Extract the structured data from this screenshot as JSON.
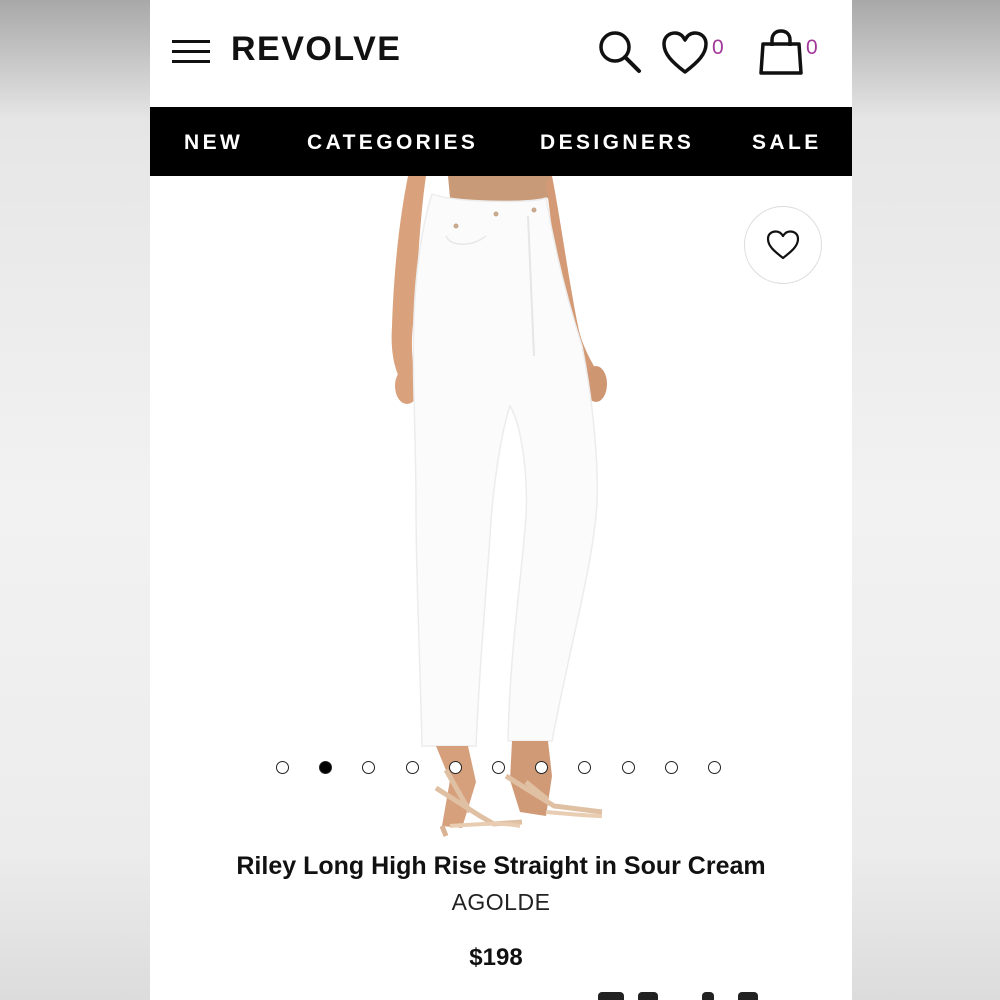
{
  "header": {
    "logo": "REVOLVE",
    "wishlist_count": "0",
    "bag_count": "0",
    "icons": {
      "menu": "hamburger-menu-icon",
      "search": "search-icon",
      "wishlist": "heart-icon",
      "bag": "shopping-bag-icon"
    },
    "count_color": "#a2379a"
  },
  "nav": {
    "items": [
      {
        "label": "NEW"
      },
      {
        "label": "CATEGORIES"
      },
      {
        "label": "DESIGNERS"
      },
      {
        "label": "SALE"
      }
    ]
  },
  "gallery": {
    "image_count": 11,
    "active_index": 1,
    "favorite_icon": "heart-icon"
  },
  "product": {
    "title": "Riley Long High Rise Straight in Sour Cream",
    "brand": "AGOLDE",
    "price": "$198"
  }
}
